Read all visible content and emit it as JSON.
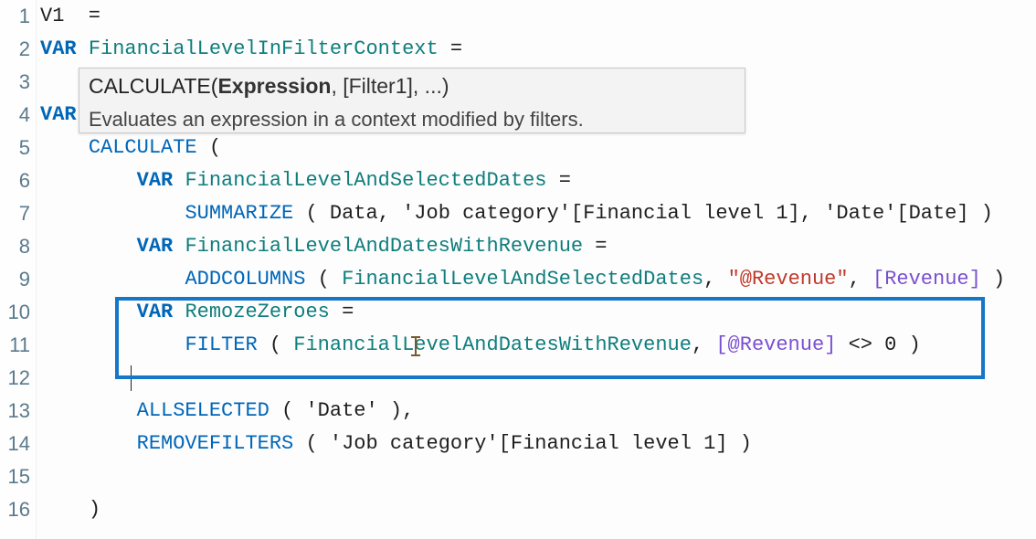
{
  "gutter": {
    "l1": "1",
    "l2": "2",
    "l3": "3",
    "l4": "4",
    "l5": "5",
    "l6": "6",
    "l7": "7",
    "l8": "8",
    "l9": "9",
    "l10": "10",
    "l11": "11",
    "l12": "12",
    "l13": "13",
    "l14": "14",
    "l15": "15",
    "l16": "16"
  },
  "code": {
    "l1_name": "V1",
    "l1_eq": "  =",
    "l2_var": "VAR ",
    "l2_name": "FinancialLevelInFilterContext",
    "l2_eq": " =",
    "l4_var": "VAR ",
    "l5_indent": "    ",
    "l5_func": "CALCULATE",
    "l5_open": " (",
    "l6_indent": "        ",
    "l6_var": "VAR ",
    "l6_name": "FinancialLevelAndSelectedDates",
    "l6_eq": " =",
    "l7_indent": "            ",
    "l7_func": "SUMMARIZE",
    "l7_rest": " ( Data, 'Job category'[Financial level 1], 'Date'[Date] )",
    "l8_indent": "        ",
    "l8_var": "VAR ",
    "l8_name": "FinancialLevelAndDatesWithRevenue",
    "l8_eq": " =",
    "l9_indent": "            ",
    "l9_func": "ADDCOLUMNS",
    "l9_open": " ( ",
    "l9_arg1": "FinancialLevelAndSelectedDates",
    "l9_c1": ", ",
    "l9_str": "\"@Revenue\"",
    "l9_c2": ", ",
    "l9_meas": "[Revenue]",
    "l9_close": " )",
    "l10_indent": "        ",
    "l10_var": "VAR ",
    "l10_name": "RemozeZeroes",
    "l10_eq": " =",
    "l11_indent": "            ",
    "l11_func": "FILTER",
    "l11_open": " ( ",
    "l11_arg1": "FinancialLevelAndDatesWithRevenue",
    "l11_c1": ", ",
    "l11_meas": "[@Revenue]",
    "l11_rest": " <> 0 )",
    "l13_indent": "        ",
    "l13_func": "ALLSELECTED",
    "l13_rest": " ( 'Date' ),",
    "l14_indent": "        ",
    "l14_func": "REMOVEFILTERS",
    "l14_rest": " ( 'Job category'[Financial level 1] )",
    "l16_indent": "    ",
    "l16_close": ")"
  },
  "tooltip": {
    "sig_fn": "CALCULATE(",
    "sig_cur": "Expression",
    "sig_rest": ", [Filter1], ...)",
    "desc": "Evaluates an expression in a context modified by filters."
  }
}
